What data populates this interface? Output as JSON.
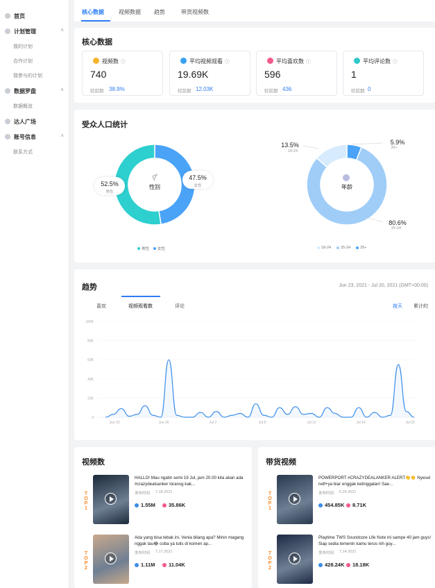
{
  "sidebar": {
    "items": [
      {
        "label": "首页",
        "top": 12
      },
      {
        "label": "计划管理",
        "top": 34,
        "chevron": "˄"
      },
      {
        "label": "我的计划",
        "sub": true,
        "top": 56
      },
      {
        "label": "合作计划",
        "sub": true,
        "top": 77
      },
      {
        "label": "我参与的计划",
        "sub": true,
        "top": 98
      },
      {
        "label": "数据罗盘",
        "top": 120,
        "chevron": "˄"
      },
      {
        "label": "数据概览",
        "sub": true,
        "top": 142
      },
      {
        "label": "达人广场",
        "top": 164
      },
      {
        "label": "账号信息",
        "top": 186,
        "chevron": "˄"
      },
      {
        "label": "联系方式",
        "sub": true,
        "top": 208
      }
    ]
  },
  "tabs": [
    "核心数据",
    "视频数据",
    "趋势",
    "带货视频数"
  ],
  "core": {
    "title": "核心数据",
    "compare_label": "较前期",
    "metrics": [
      {
        "label": "视频数",
        "value": "740",
        "compare": "38.9%",
        "icon": "video-count-icon",
        "color": "#f7b42c"
      },
      {
        "label": "平均视频观看",
        "value": "19.69K",
        "compare": "12.03K",
        "icon": "view-icon",
        "color": "#3aa0f0"
      },
      {
        "label": "平均喜欢数",
        "value": "596",
        "compare": "436",
        "icon": "like-icon",
        "color": "#f25a8a"
      },
      {
        "label": "平均评论数",
        "value": "1",
        "compare": "0",
        "icon": "comment-icon",
        "color": "#30c8c8"
      }
    ]
  },
  "audience": {
    "title": "受众人口统计",
    "gender": {
      "center_label": "性别",
      "segments": [
        {
          "name": "男性",
          "pct": "52.5%",
          "value": 52.5,
          "color": "#2ecfcf"
        },
        {
          "name": "女性",
          "pct": "47.5%",
          "value": 47.5,
          "color": "#4aa3f7"
        }
      ]
    },
    "age": {
      "center_label": "年龄",
      "segments": [
        {
          "name": "18-24",
          "pct": "13.5%",
          "value": 13.5,
          "color": "#d6ebfd"
        },
        {
          "name": "25-34",
          "pct": "80.6%",
          "value": 80.6,
          "color": "#9fcdf8"
        },
        {
          "name": "35+",
          "pct": "5.9%",
          "value": 5.9,
          "color": "#4aa3f7"
        }
      ]
    }
  },
  "trend": {
    "title": "趋势",
    "range": "Jun 23, 2021 - Jul 20, 2021 (GMT+00:00)",
    "tabs": [
      "喜欢",
      "视频观看数",
      "评论"
    ],
    "toggle_daily": "按天",
    "toggle_cumulative": "累计的",
    "chart_data": {
      "type": "line",
      "yticks": [
        "100K",
        "80K",
        "60K",
        "40K",
        "20K",
        "0"
      ],
      "xticks": [
        "Jun 23",
        "Jun 26",
        "Jul 2",
        "Jul 8",
        "Jul 12",
        "Jul 16",
        "Jul 20"
      ],
      "ylim": [
        0,
        100000
      ],
      "values": [
        0,
        3000,
        9000,
        1000,
        3000,
        12000,
        2000,
        0,
        60000,
        2000,
        0,
        0,
        5000,
        0,
        6000,
        0,
        2000,
        4000,
        0,
        14000,
        2000,
        0,
        10000,
        3000,
        11000,
        3000,
        4000,
        0,
        10000,
        4000,
        0,
        0,
        10000,
        0,
        5000,
        0,
        2000,
        55000,
        6000,
        0
      ]
    }
  },
  "videos": {
    "title": "视频数",
    "date_label": "发布时间",
    "items": [
      {
        "title": "HALLO! Mau ngatin semi 19 Jul, jam 20.00 kita akan ada #crazydealsanker loransg kak...",
        "date": "7.18.2021",
        "views": "1.55M",
        "likes": "35.86K",
        "bg": "#1a2a3a"
      },
      {
        "title": "Ada yang bisa tebak ini. Venia bilang apa? Minin magang nggak tau😂 coba ya tulis di komen ap...",
        "date": "7.17.2021",
        "views": "1.11M",
        "likes": "11.04K",
        "bg": "#c9a98c"
      }
    ]
  },
  "goods": {
    "title": "带货视频",
    "date_label": "发布时间",
    "items": [
      {
        "title": "POWERPORT #CRAZYDEALANKER ALERT👏👏 Nyesel nelf+ya biar enggak ketinggalan! Sae...",
        "date": "6.24.2021",
        "views": "454.85K",
        "likes": "8.71K",
        "bg": "#2a3a4e"
      },
      {
        "title": "Playtime TWS Soundcore Life Note ini sampe 40 jam guys! Siap sedia temenin kamu terus nih guy...",
        "date": "7.14.2021",
        "views": "428.24K",
        "likes": "18.18K",
        "bg": "#1e2a44"
      }
    ]
  },
  "rank_labels": [
    "TOP 1",
    "TOP 2"
  ]
}
